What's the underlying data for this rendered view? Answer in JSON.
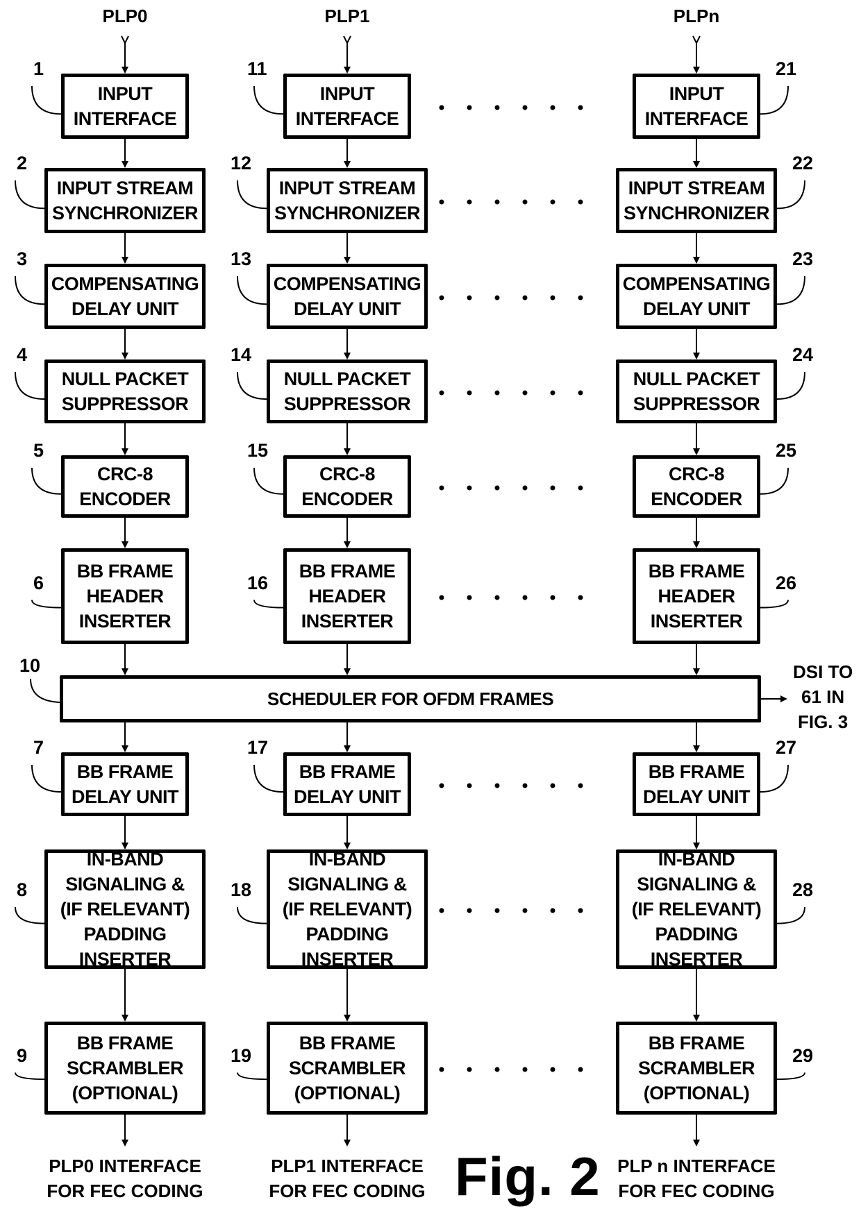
{
  "figure_label": "Fig. 2",
  "columns": [
    {
      "id": "plp0",
      "input_label": "PLP0",
      "output_label": [
        "PLP0 INTERFACE",
        "FOR FEC CODING"
      ],
      "blocks": [
        {
          "ref": "1",
          "lines": [
            "INPUT",
            "INTERFACE"
          ]
        },
        {
          "ref": "2",
          "lines": [
            "INPUT STREAM",
            "SYNCHRONIZER"
          ]
        },
        {
          "ref": "3",
          "lines": [
            "COMPENSATING",
            "DELAY UNIT"
          ]
        },
        {
          "ref": "4",
          "lines": [
            "NULL PACKET",
            "SUPPRESSOR"
          ]
        },
        {
          "ref": "5",
          "lines": [
            "CRC-8",
            "ENCODER"
          ]
        },
        {
          "ref": "6",
          "lines": [
            "BB FRAME",
            "HEADER",
            "INSERTER"
          ]
        },
        {
          "ref": "7",
          "lines": [
            "BB FRAME",
            "DELAY UNIT"
          ]
        },
        {
          "ref": "8",
          "lines": [
            "IN-BAND",
            "SIGNALING &",
            "(IF RELEVANT)",
            "PADDING",
            "INSERTER"
          ]
        },
        {
          "ref": "9",
          "lines": [
            "BB FRAME",
            "SCRAMBLER",
            "(OPTIONAL)"
          ]
        }
      ]
    },
    {
      "id": "plp1",
      "input_label": "PLP1",
      "output_label": [
        "PLP1 INTERFACE",
        "FOR FEC CODING"
      ],
      "blocks": [
        {
          "ref": "11",
          "lines": [
            "INPUT",
            "INTERFACE"
          ]
        },
        {
          "ref": "12",
          "lines": [
            "INPUT STREAM",
            "SYNCHRONIZER"
          ]
        },
        {
          "ref": "13",
          "lines": [
            "COMPENSATING",
            "DELAY UNIT"
          ]
        },
        {
          "ref": "14",
          "lines": [
            "NULL PACKET",
            "SUPPRESSOR"
          ]
        },
        {
          "ref": "15",
          "lines": [
            "CRC-8",
            "ENCODER"
          ]
        },
        {
          "ref": "16",
          "lines": [
            "BB FRAME",
            "HEADER",
            "INSERTER"
          ]
        },
        {
          "ref": "17",
          "lines": [
            "BB FRAME",
            "DELAY UNIT"
          ]
        },
        {
          "ref": "18",
          "lines": [
            "IN-BAND",
            "SIGNALING &",
            "(IF RELEVANT)",
            "PADDING",
            "INSERTER"
          ]
        },
        {
          "ref": "19",
          "lines": [
            "BB FRAME",
            "SCRAMBLER",
            "(OPTIONAL)"
          ]
        }
      ]
    },
    {
      "id": "plpn",
      "input_label": "PLPn",
      "output_label": [
        "PLP n INTERFACE",
        "FOR FEC CODING"
      ],
      "blocks": [
        {
          "ref": "21",
          "lines": [
            "INPUT",
            "INTERFACE"
          ]
        },
        {
          "ref": "22",
          "lines": [
            "INPUT STREAM",
            "SYNCHRONIZER"
          ]
        },
        {
          "ref": "23",
          "lines": [
            "COMPENSATING",
            "DELAY UNIT"
          ]
        },
        {
          "ref": "24",
          "lines": [
            "NULL PACKET",
            "SUPPRESSOR"
          ]
        },
        {
          "ref": "25",
          "lines": [
            "CRC-8",
            "ENCODER"
          ]
        },
        {
          "ref": "26",
          "lines": [
            "BB FRAME",
            "HEADER",
            "INSERTER"
          ]
        },
        {
          "ref": "27",
          "lines": [
            "BB FRAME",
            "DELAY UNIT"
          ]
        },
        {
          "ref": "28",
          "lines": [
            "IN-BAND",
            "SIGNALING &",
            "(IF RELEVANT)",
            "PADDING",
            "INSERTER"
          ]
        },
        {
          "ref": "29",
          "lines": [
            "BB FRAME",
            "SCRAMBLER",
            "(OPTIONAL)"
          ]
        }
      ]
    }
  ],
  "scheduler": {
    "ref": "10",
    "label": "SCHEDULER FOR OFDM FRAMES",
    "output_label": [
      "DSI TO",
      "61 IN",
      "FIG. 3"
    ]
  }
}
